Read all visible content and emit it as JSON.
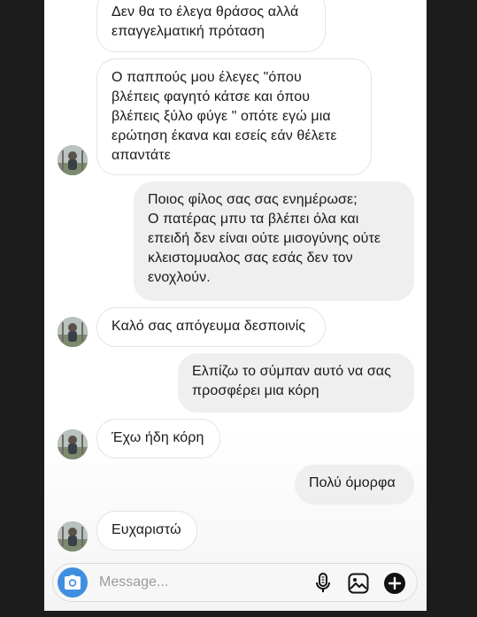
{
  "conversation": {
    "messages": [
      {
        "sender": "them",
        "lines": [
          "Δεν θα το έλεγα θράσος αλλά",
          "επαγγελματική πρόταση"
        ]
      },
      {
        "sender": "them",
        "lines": [
          "Ο παππούς μου έλεγες \"όπου",
          "βλέπεις φαγητό κάτσε και όπου",
          "βλέπεις ξύλο φύγε \" οπότε εγώ μια",
          "ερώτηση έκανα και εσείς εάν θέλετε",
          "απαντάτε"
        ]
      },
      {
        "sender": "me",
        "lines": [
          "Ποιος φίλος σας σας ενημέρωσε;",
          "Ο πατέρας μπυ τα βλέπει όλα και",
          "επειδή δεν είναι ούτε μισογύνης ούτε",
          "κλειστομυαλος σας εσάς δεν τον",
          "ενοχλούν."
        ]
      },
      {
        "sender": "them",
        "lines": [
          "Καλό σας απόγευμα δεσποινίς"
        ]
      },
      {
        "sender": "me",
        "lines": [
          "Ελπίζω το σύμπαν αυτό να σας",
          "προσφέρει μια κόρη"
        ]
      },
      {
        "sender": "them",
        "lines": [
          "Έχω ήδη κόρη"
        ]
      },
      {
        "sender": "me",
        "lines": [
          "Πολύ όμορφα"
        ]
      },
      {
        "sender": "them",
        "lines": [
          "Ευχαριστώ"
        ]
      }
    ]
  },
  "composer": {
    "placeholder": "Message...",
    "value": "",
    "icons": {
      "camera": "camera-icon",
      "microphone": "microphone-icon",
      "gallery": "gallery-icon",
      "add": "add-icon"
    },
    "colors": {
      "camera_button": "#3f8fe0"
    }
  },
  "colors": {
    "background": "#1c1c1c",
    "panel": "#ffffff",
    "incoming_bubble": "#ffffff",
    "incoming_border": "#e3e3e3",
    "outgoing_bubble": "#efefef",
    "text": "#1a1a1a"
  }
}
